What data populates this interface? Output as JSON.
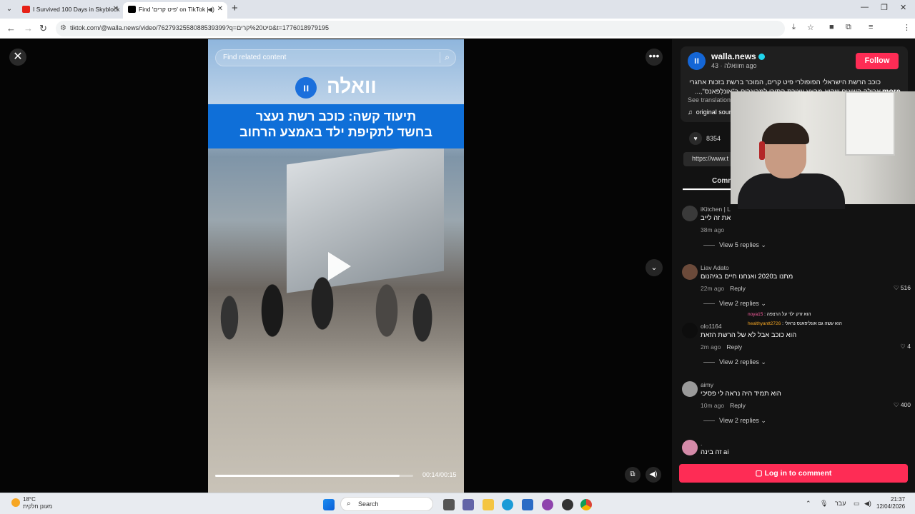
{
  "browser": {
    "tabs": [
      {
        "label": "I Survived 100 Days in Skyblock",
        "favicon_color": "#e62117"
      },
      {
        "label": "Find 'פיט קרים' on TikTok |",
        "favicon_color": "#000000"
      }
    ],
    "url": "tiktok.com/@walla.news/video/7627932558088539399?q=פיט%20קרים&t=1776018979195"
  },
  "video": {
    "search_placeholder": "Find related content",
    "logo_text": "וואלה",
    "logo_badge": "וו",
    "headline_line1": "תיעוד קשה: כוכב רשת נעצר",
    "headline_line2": "בחשד לתקיפת ילד באמצע הרחוב",
    "time": "00:14/00:15",
    "progress_fraction": 0.93
  },
  "post": {
    "username": "walla.news",
    "subline": "וואלה · 43m ago",
    "follow_label": "Follow",
    "description_line1": "כוכב הרשת הישראלי הפופולרי פיט קרים, המוכר ברשת בזכות אתגרי",
    "description_line2": "אכילה השונים שהוא מבצע ויצירת התוכן למבוגרים ב\"אונלִפאנס\",...",
    "more_label": "more",
    "see_translation": "See translation",
    "sound": "original sound - וואלה",
    "likes": "8354",
    "link_text": "https://www.t",
    "comments_tab": "Comm"
  },
  "comments": [
    {
      "name": "iKitchen | L",
      "text": "את זה לייב",
      "time": "38m ago",
      "reply": "",
      "likes": "",
      "replies": "View 5 replies",
      "avatar_color": "#3a3a3a"
    },
    {
      "name": "Liav Adato",
      "text": "מתנו ב2020 ואנחנו חיים בגיהנום",
      "time": "22m ago",
      "reply": "Reply",
      "likes": "516",
      "replies": "View 2 replies",
      "avatar_color": "#6b4a3a"
    },
    {
      "name": "olo1164",
      "text": "הוא כוכב אבל לא של הרשת הזאת",
      "time": "2m ago",
      "reply": "Reply",
      "likes": "4",
      "replies": "View 2 replies",
      "avatar_color": "#0d0d0d"
    },
    {
      "name": "aimy",
      "text": "הוא תמיד היה נראה לי פסיכי",
      "time": "10m ago",
      "reply": "Reply",
      "likes": "400",
      "replies": "View 2 replies",
      "avatar_color": "#9a9a9a"
    },
    {
      "name": ".",
      "text": "זה בינה ai",
      "time": "",
      "reply": "",
      "likes": "",
      "replies": "",
      "avatar_color": "#d48aa8"
    }
  ],
  "overlay_chat": [
    {
      "user": "noya15",
      "msg": "הוא זרק ילד על הרצפה",
      "color": "#ff5fa2"
    },
    {
      "user": "healthyantt2726",
      "msg": "הוא עשה גם אונליפאנס נראלי",
      "color": "#f5a623"
    }
  ],
  "login_label": "Log in to comment",
  "taskbar": {
    "temp": "18°C",
    "weather_text": "מעונן חלקית",
    "search_label": "Search",
    "lang": "עבר",
    "time": "21:37",
    "date": "12/04/2026"
  }
}
